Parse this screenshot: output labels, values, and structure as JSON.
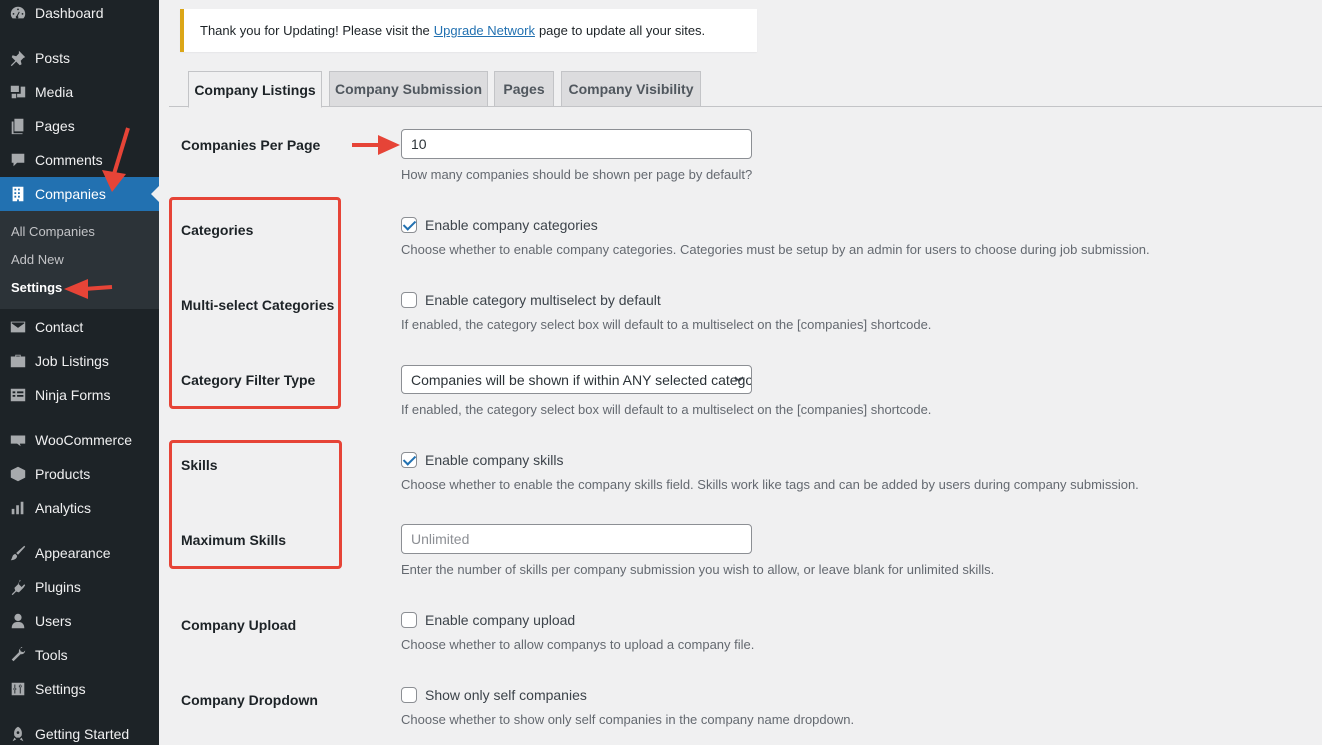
{
  "sidebar": {
    "items": [
      {
        "label": "Dashboard",
        "icon": "dashboard-icon"
      },
      {
        "label": "Posts",
        "icon": "pin-icon"
      },
      {
        "label": "Media",
        "icon": "media-icon"
      },
      {
        "label": "Pages",
        "icon": "pages-icon"
      },
      {
        "label": "Comments",
        "icon": "comments-icon"
      },
      {
        "label": "Companies",
        "icon": "building-icon"
      },
      {
        "label": "Contact",
        "icon": "mail-icon"
      },
      {
        "label": "Job Listings",
        "icon": "briefcase-icon"
      },
      {
        "label": "Ninja Forms",
        "icon": "forms-icon"
      },
      {
        "label": "WooCommerce",
        "icon": "woo-icon"
      },
      {
        "label": "Products",
        "icon": "products-icon"
      },
      {
        "label": "Analytics",
        "icon": "analytics-icon"
      },
      {
        "label": "Appearance",
        "icon": "brush-icon"
      },
      {
        "label": "Plugins",
        "icon": "plugin-icon"
      },
      {
        "label": "Users",
        "icon": "users-icon"
      },
      {
        "label": "Tools",
        "icon": "wrench-icon"
      },
      {
        "label": "Settings",
        "icon": "sliders-icon"
      },
      {
        "label": "Getting Started",
        "icon": "rocket-icon"
      }
    ],
    "submenu": [
      "All Companies",
      "Add New",
      "Settings"
    ]
  },
  "notice": {
    "before": "Thank you for Updating! Please visit the",
    "link": "Upgrade Network",
    "after": "page to update all your sites."
  },
  "tabs": [
    "Company Listings",
    "Company Submission",
    "Pages",
    "Company Visibility"
  ],
  "fields": {
    "per_page": {
      "label": "Companies Per Page",
      "value": "10",
      "desc": "How many companies should be shown per page by default?"
    },
    "categories": {
      "label": "Categories",
      "checkbox": "Enable company categories",
      "checked": true,
      "desc": "Choose whether to enable company categories. Categories must be setup by an admin for users to choose during job submission."
    },
    "multiselect": {
      "label": "Multi-select Categories",
      "checkbox": "Enable category multiselect by default",
      "checked": false,
      "desc": "If enabled, the category select box will default to a multiselect on the [companies] shortcode."
    },
    "filter_type": {
      "label": "Category Filter Type",
      "selected": "Companies will be shown if within ANY selected category",
      "desc": "If enabled, the category select box will default to a multiselect on the [companies] shortcode."
    },
    "skills": {
      "label": "Skills",
      "checkbox": "Enable company skills",
      "checked": true,
      "desc": "Choose whether to enable the company skills field. Skills work like tags and can be added by users during company submission."
    },
    "max_skills": {
      "label": "Maximum Skills",
      "placeholder": "Unlimited",
      "desc": "Enter the number of skills per company submission you wish to allow, or leave blank for unlimited skills."
    },
    "upload": {
      "label": "Company Upload",
      "checkbox": "Enable company upload",
      "checked": false,
      "desc": "Choose whether to allow companys to upload a company file."
    },
    "dropdown": {
      "label": "Company Dropdown",
      "checkbox": "Show only self companies",
      "checked": false,
      "desc": "Choose whether to show only self companies in the company name dropdown."
    }
  },
  "colors": {
    "sidebar_bg": "#1d2327",
    "accent": "#2271b1",
    "annotation": "#e64437",
    "notice_border": "#dba617"
  }
}
